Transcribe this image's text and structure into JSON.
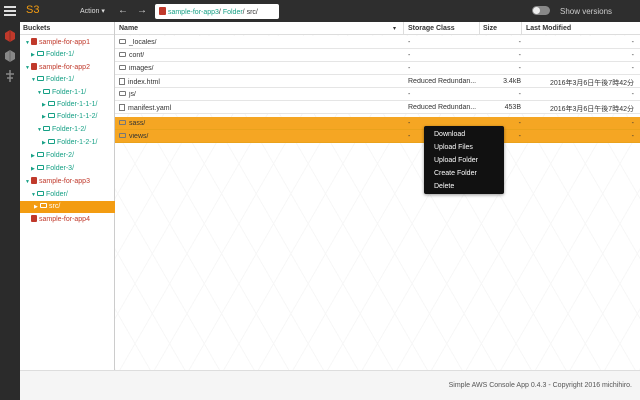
{
  "app": {
    "brand": "S3"
  },
  "toolbar": {
    "action_label": "Action ▾",
    "back_icon": "arrow-left-icon",
    "forward_icon": "arrow-right-icon",
    "show_versions_label": "Show versions"
  },
  "breadcrumb": {
    "bucket": "sample-for-app3",
    "folder": "Folder",
    "current": "src/",
    "sep": "/"
  },
  "sidebar": {
    "header": "Buckets",
    "items": [
      {
        "label": "sample-for-app1",
        "kind": "bucket"
      },
      {
        "label": "Folder-1/",
        "kind": "folder"
      },
      {
        "label": "sample-for-app2",
        "kind": "bucket"
      },
      {
        "label": "Folder-1/",
        "kind": "folder"
      },
      {
        "label": "Folder-1-1/",
        "kind": "folder"
      },
      {
        "label": "Folder-1-1-1/",
        "kind": "folder"
      },
      {
        "label": "Folder-1-1-2/",
        "kind": "folder"
      },
      {
        "label": "Folder-1-2/",
        "kind": "folder"
      },
      {
        "label": "Folder-1-2-1/",
        "kind": "folder"
      },
      {
        "label": "Folder-2/",
        "kind": "folder"
      },
      {
        "label": "Folder-3/",
        "kind": "folder"
      },
      {
        "label": "sample-for-app3",
        "kind": "bucket"
      },
      {
        "label": "Folder/",
        "kind": "folder"
      },
      {
        "label": "src/",
        "kind": "folder",
        "selected": true
      },
      {
        "label": "sample-for-app4",
        "kind": "bucket"
      }
    ]
  },
  "table": {
    "columns": {
      "name": "Name",
      "storage_class": "Storage Class",
      "size": "Size",
      "last_modified": "Last Modified"
    },
    "rows": [
      {
        "name": "_locales/",
        "type": "folder",
        "storage_class": "-",
        "size": "-",
        "last_modified": "-"
      },
      {
        "name": "conf/",
        "type": "folder",
        "storage_class": "-",
        "size": "-",
        "last_modified": "-"
      },
      {
        "name": "images/",
        "type": "folder",
        "storage_class": "-",
        "size": "-",
        "last_modified": "-"
      },
      {
        "name": "index.html",
        "type": "file",
        "storage_class": "Reduced Redundan...",
        "size": "3.4kB",
        "last_modified": "2016年3月6日午後7時42分"
      },
      {
        "name": "js/",
        "type": "folder",
        "storage_class": "-",
        "size": "-",
        "last_modified": "-"
      },
      {
        "name": "manifest.yaml",
        "type": "file",
        "storage_class": "Reduced Redundan...",
        "size": "453B",
        "last_modified": "2016年3月6日午後7時42分"
      },
      {
        "name": "sass/",
        "type": "folder",
        "storage_class": "-",
        "size": "-",
        "last_modified": "-",
        "selected": true
      },
      {
        "name": "views/",
        "type": "folder",
        "storage_class": "-",
        "size": "-",
        "last_modified": "-",
        "selected": true
      }
    ]
  },
  "context_menu": {
    "items": [
      "Download",
      "Upload Files",
      "Upload Folder",
      "Create Folder",
      "Delete"
    ]
  },
  "footer": {
    "text": "Simple AWS Console App 0.4.3 - Copyright 2016 michihiro."
  },
  "colors": {
    "accent": "#f39c12",
    "link": "#16a085",
    "bucket": "#c0392b",
    "dark": "#2e2e2e"
  }
}
